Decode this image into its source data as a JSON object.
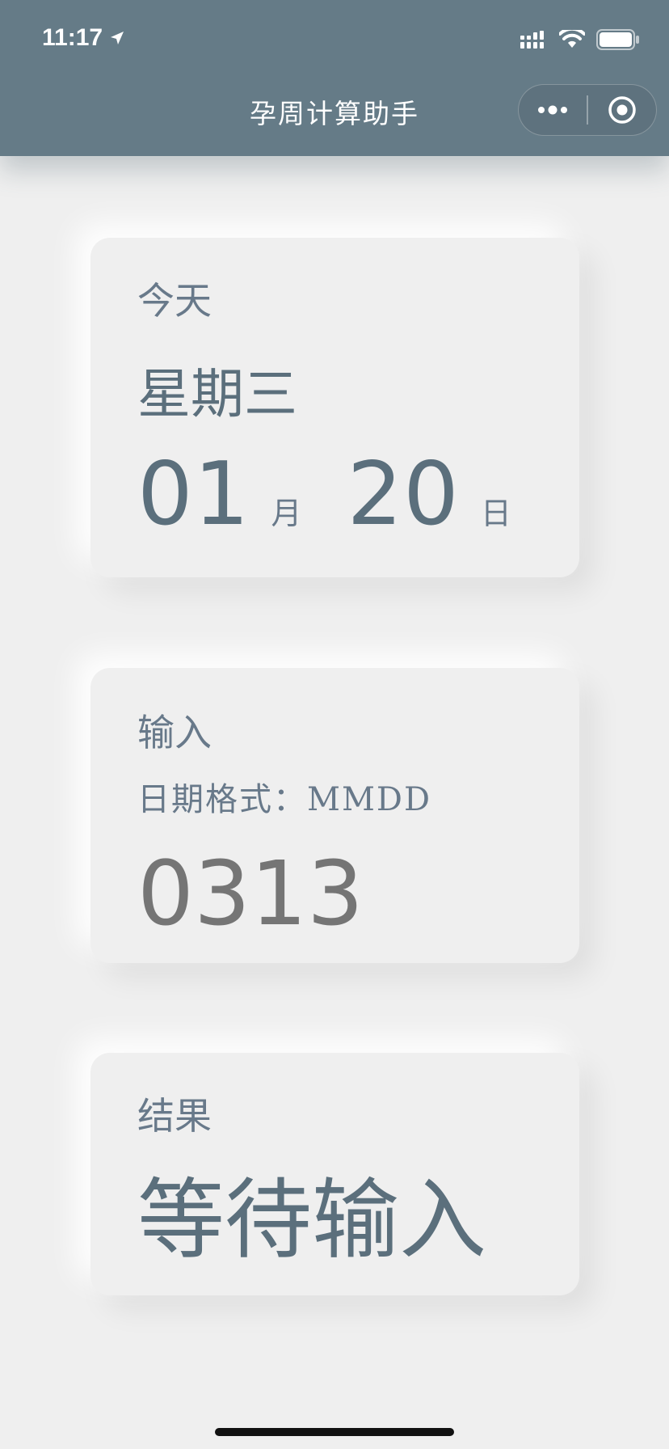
{
  "status_bar": {
    "time": "11:17"
  },
  "nav": {
    "title": "孕周计算助手"
  },
  "today": {
    "label": "今天",
    "weekday": "星期三",
    "month": "01",
    "month_unit": "月",
    "day": "20",
    "day_unit": "日"
  },
  "input": {
    "label": "输入",
    "hint": "日期格式：MMDD",
    "placeholder": "0313"
  },
  "result": {
    "label": "结果",
    "value": "等待输入"
  },
  "colors": {
    "nav_bg": "#657b87",
    "page_bg": "#efefef",
    "text_primary": "#5b6f7c",
    "placeholder": "#acb7bf"
  },
  "icons": [
    "location-arrow-icon",
    "cellular-signal-icon",
    "wifi-icon",
    "battery-icon",
    "more-dots-icon",
    "close-target-icon"
  ]
}
